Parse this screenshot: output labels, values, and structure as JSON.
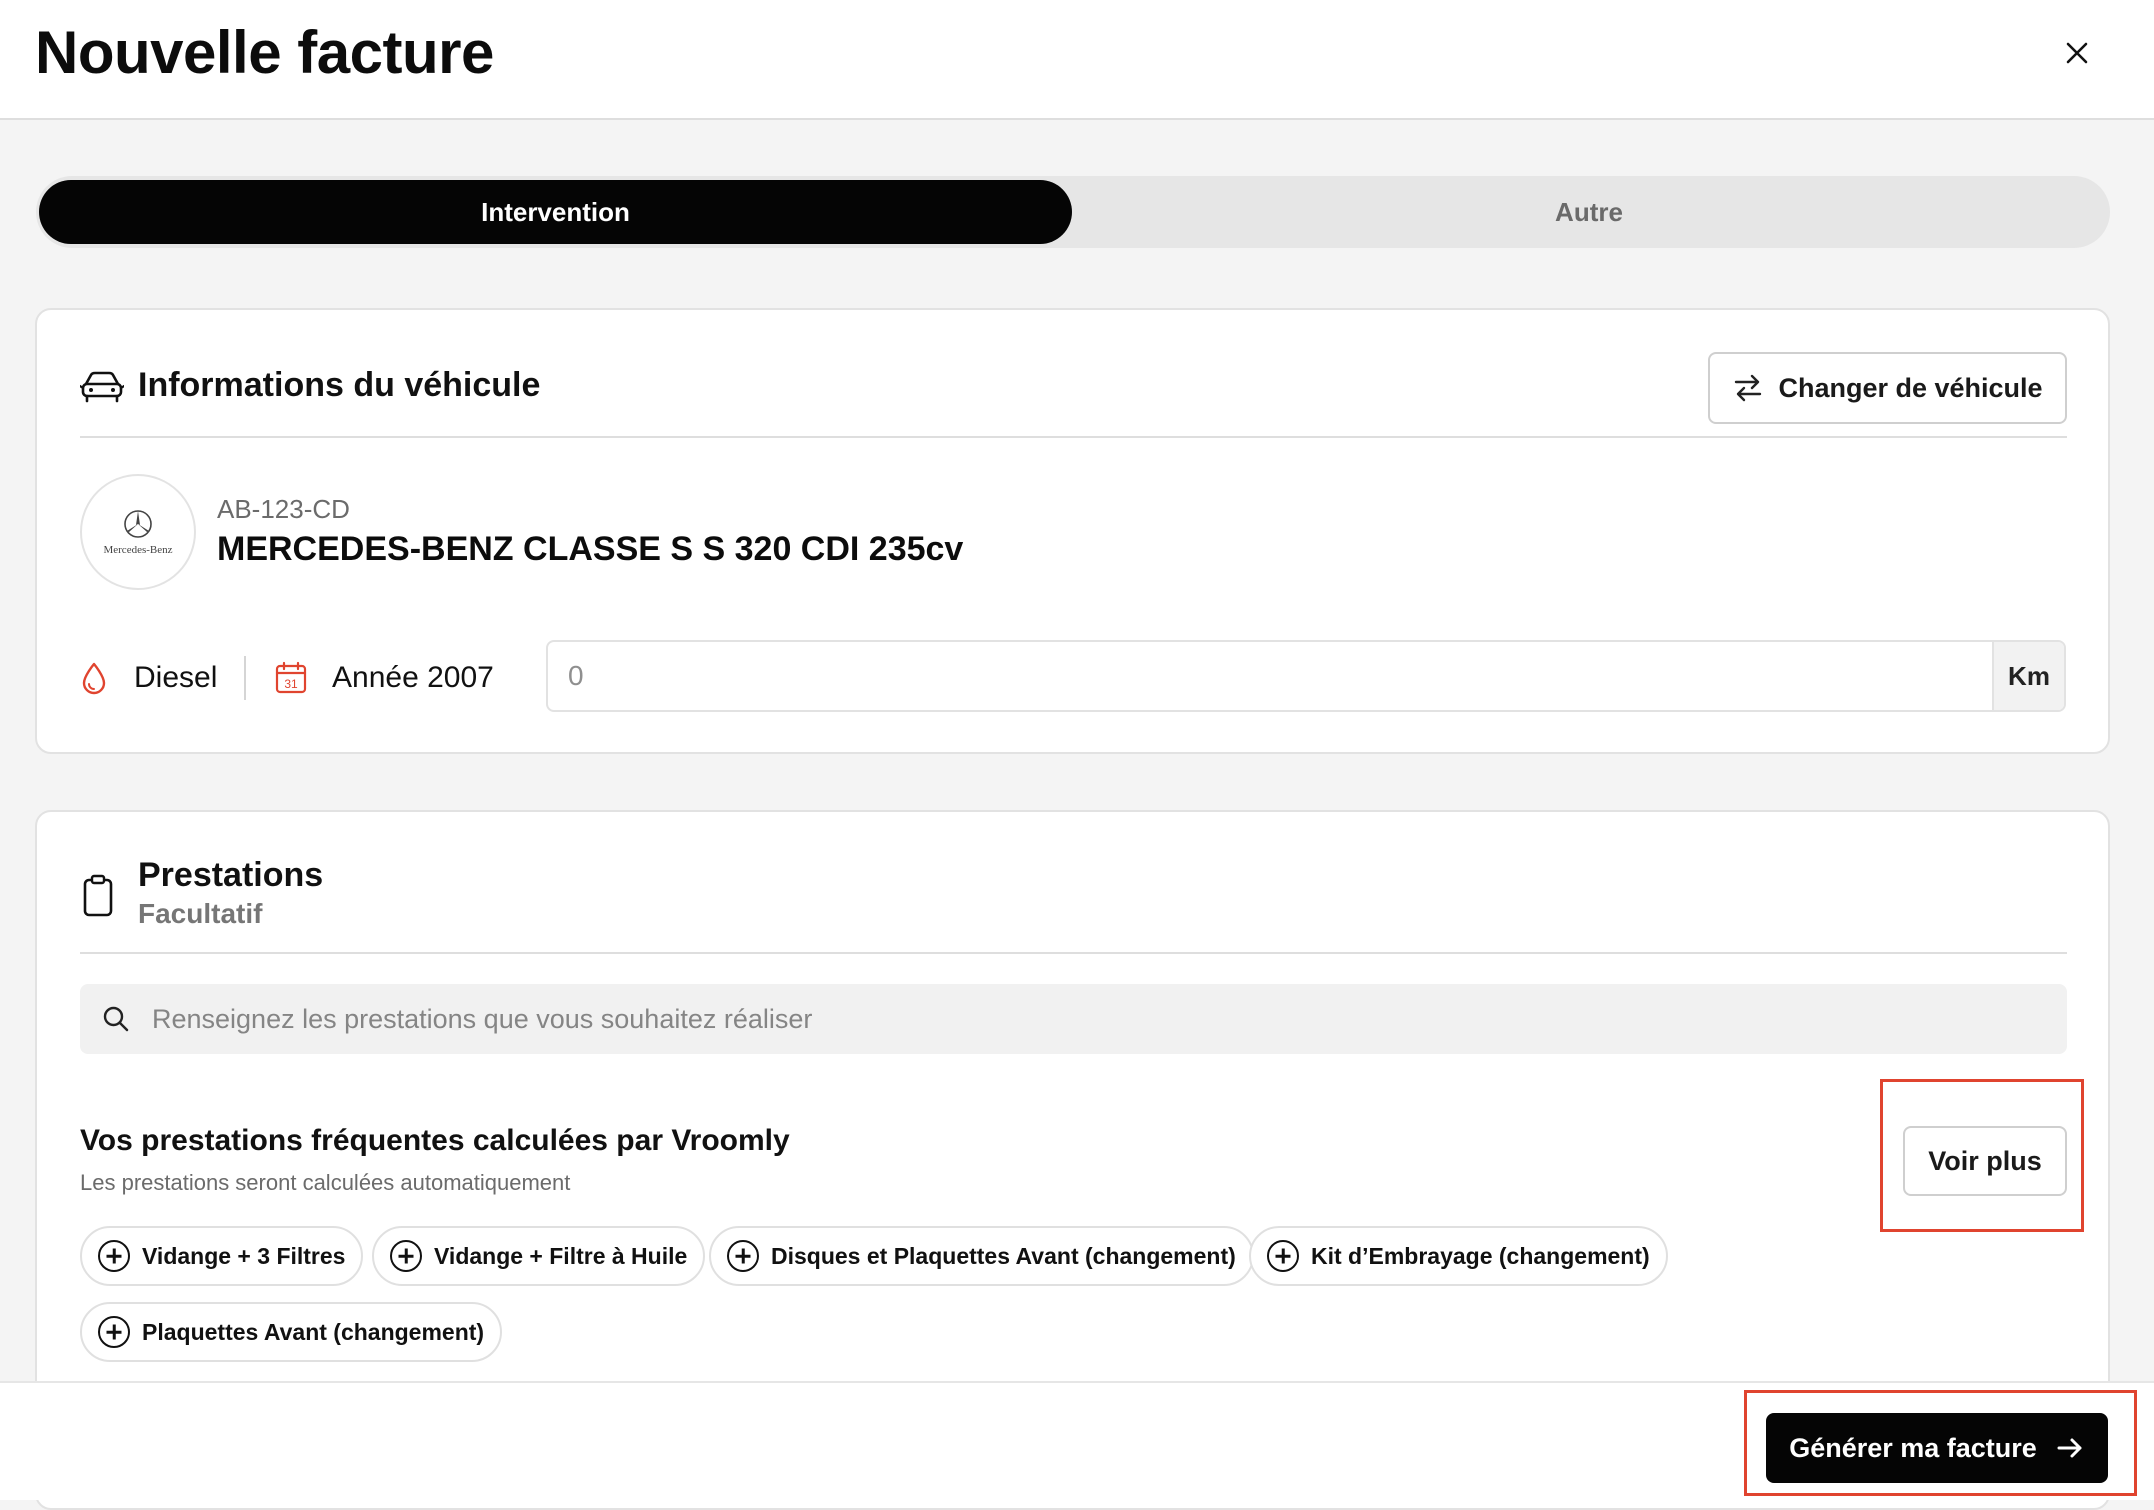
{
  "header": {
    "title": "Nouvelle facture"
  },
  "tabs": [
    {
      "label": "Intervention",
      "active": true
    },
    {
      "label": "Autre",
      "active": false
    }
  ],
  "vehicle_card": {
    "title": "Informations du véhicule",
    "change_button": "Changer de véhicule",
    "brand_logo_text": "Mercedes-Benz",
    "plate": "AB-123-CD",
    "model": "MERCEDES-BENZ CLASSE S S 320 CDI 235cv",
    "fuel": "Diesel",
    "year": "Année 2007",
    "calendar_day": "31",
    "mileage": {
      "placeholder": "0",
      "unit": "Km"
    }
  },
  "services_card": {
    "title": "Prestations",
    "subtitle": "Facultatif",
    "search_placeholder": "Renseignez les prestations que vous souhaitez réaliser",
    "frequent_title": "Vos prestations fréquentes calculées par Vroomly",
    "frequent_subtitle": "Les prestations seront calculées automatiquement",
    "see_more": "Voir plus",
    "chips": [
      "Vidange + 3 Filtres",
      "Vidange + Filtre à Huile",
      "Disques et Plaquettes Avant (changement)",
      "Kit d’Embrayage (changement)",
      "Plaquettes Avant (changement)"
    ]
  },
  "footer": {
    "generate_button": "Générer ma facture"
  },
  "colors": {
    "primary": "#050505",
    "accent_red": "#e0442f",
    "background": "#f4f4f4"
  }
}
